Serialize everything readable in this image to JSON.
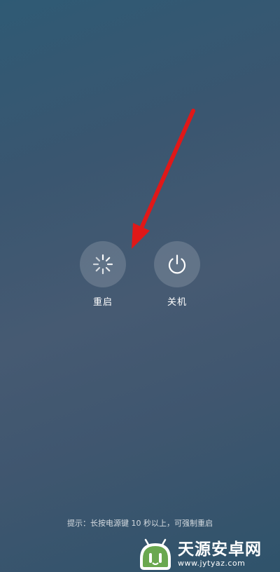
{
  "power_menu": {
    "restart": {
      "label": "重启",
      "icon": "restart-spinner-icon"
    },
    "shutdown": {
      "label": "关机",
      "icon": "power-icon"
    },
    "hint": "提示：长按电源键 10 秒以上，可强制重启"
  },
  "annotation": {
    "arrow_color": "#e01818"
  },
  "watermark": {
    "title": "天源安卓网",
    "url": "www.jytyaz.com"
  },
  "colors": {
    "button_bg": "rgba(255,255,255,0.16)",
    "label": "#ffffff"
  }
}
